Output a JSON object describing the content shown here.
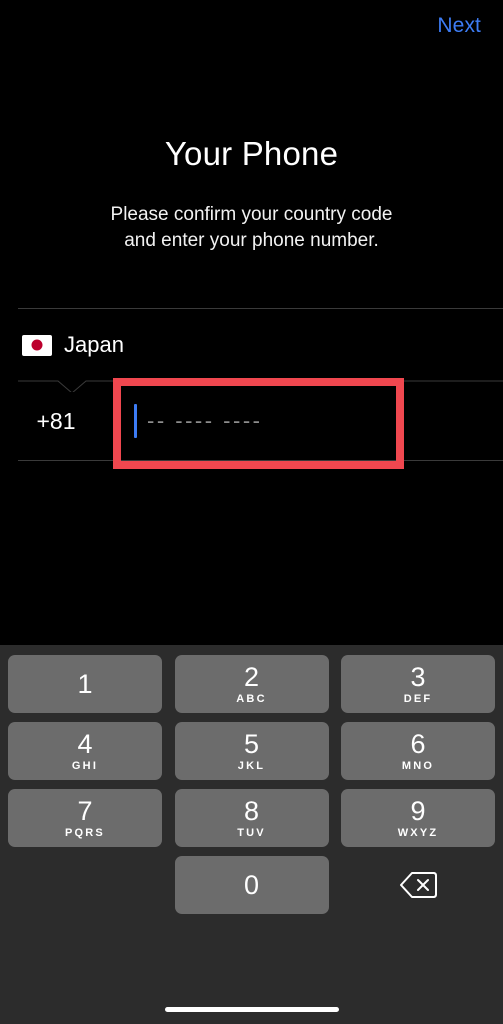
{
  "navbar": {
    "next_label": "Next"
  },
  "header": {
    "title": "Your Phone",
    "subtitle_line1": "Please confirm your country code",
    "subtitle_line2": "and enter your phone number."
  },
  "form": {
    "country_name": "Japan",
    "country_flag_icon": "japan-flag-icon",
    "dial_code": "+81",
    "phone_value": "",
    "phone_placeholder": "-- ---- ----"
  },
  "annotation": {
    "color": "#f0474f",
    "target": "phone-number-input"
  },
  "keypad": {
    "rows": [
      [
        {
          "digit": "1",
          "letters": ""
        },
        {
          "digit": "2",
          "letters": "ABC"
        },
        {
          "digit": "3",
          "letters": "DEF"
        }
      ],
      [
        {
          "digit": "4",
          "letters": "GHI"
        },
        {
          "digit": "5",
          "letters": "JKL"
        },
        {
          "digit": "6",
          "letters": "MNO"
        }
      ],
      [
        {
          "digit": "7",
          "letters": "PQRS"
        },
        {
          "digit": "8",
          "letters": "TUV"
        },
        {
          "digit": "9",
          "letters": "WXYZ"
        }
      ]
    ],
    "zero": {
      "digit": "0",
      "letters": ""
    },
    "backspace_icon": "backspace-delete-icon",
    "key_color": "#6c6c6c",
    "background_color": "#2c2c2c"
  },
  "colors": {
    "accent_blue": "#3d7cf4",
    "background": "#000000",
    "divider": "#3a3a3a"
  }
}
